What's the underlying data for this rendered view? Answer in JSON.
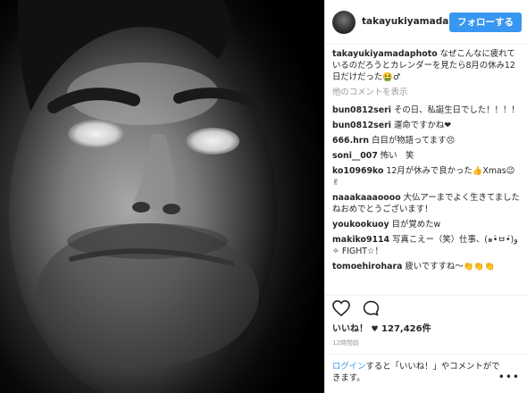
{
  "header": {
    "username": "takayukiyamadapl",
    "follow_label": "フォローする"
  },
  "caption": {
    "username": "takayukiyamadaphoto",
    "text": "なぜこんなに疲れているのだろうとカレンダーを見たら8月の休み12日だけだった🤮♂"
  },
  "more_comments_label": "他のコメントを表示",
  "comments": [
    {
      "username": "bun0812seri",
      "text": "その日、私誕生日でした！！！！"
    },
    {
      "username": "bun0812seri",
      "text": "運命ですかね❤"
    },
    {
      "username": "666.hrn",
      "text": "白目が物語ってます😣"
    },
    {
      "username": "soni__007",
      "text": "怖い　笑"
    },
    {
      "username": "ko10969ko",
      "text": "12月が休みで良かった👍Xmas😉✌"
    },
    {
      "username": "naaakaaaoooo",
      "text": "大仏アーまでよく生きてましたねおめでとうございます！"
    },
    {
      "username": "youkookuoy",
      "text": "目が覚めたw"
    },
    {
      "username": "makiko9114",
      "text": "写真こえー（笑）仕事、(๑•̀ㅂ•́)و✧ FIGHT☆！"
    },
    {
      "username": "tomoehirohara",
      "text": "疲いですすね〜👏👏👏"
    }
  ],
  "actions": {
    "like_icon": "heart-icon",
    "comment_icon": "comment-icon"
  },
  "likes": {
    "label": "いいね！",
    "count": "127,426件"
  },
  "time_ago": "12時間前",
  "login_prompt": {
    "link": "ログイン",
    "text": "すると「いいね！」やコメントができます。",
    "more_icon": "more-options-icon"
  },
  "colors": {
    "accent": "#3897f0",
    "muted": "#999999",
    "text": "#262626"
  }
}
